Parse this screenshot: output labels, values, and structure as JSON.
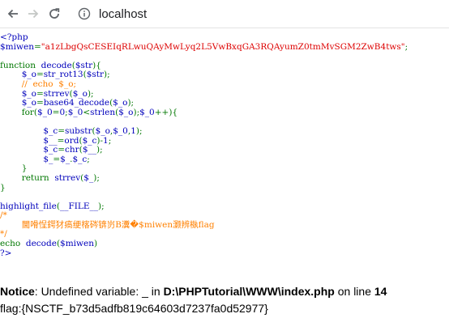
{
  "browser": {
    "url": "localhost"
  },
  "code_lines": [
    [
      {
        "c": "default",
        "t": "<?php"
      }
    ],
    [
      {
        "c": "default",
        "t": "$miwen"
      },
      {
        "c": "keyword",
        "t": "="
      },
      {
        "c": "string",
        "t": "\"a1zLbgQsCESEIqRLwuQAyMwLyq2L5VwBxqGA3RQAyumZ0tmMvSGM2ZwB4tws\""
      },
      {
        "c": "keyword",
        "t": ";"
      }
    ],
    [],
    [
      {
        "c": "keyword",
        "t": "function  "
      },
      {
        "c": "default",
        "t": "decode"
      },
      {
        "c": "keyword",
        "t": "("
      },
      {
        "c": "default",
        "t": "$str"
      },
      {
        "c": "keyword",
        "t": "){"
      }
    ],
    [
      {
        "c": "keyword",
        "t": "        "
      },
      {
        "c": "default",
        "t": "$_o"
      },
      {
        "c": "keyword",
        "t": "="
      },
      {
        "c": "default",
        "t": "str_rot13"
      },
      {
        "c": "keyword",
        "t": "("
      },
      {
        "c": "default",
        "t": "$str"
      },
      {
        "c": "keyword",
        "t": ");"
      }
    ],
    [
      {
        "c": "keyword",
        "t": "        "
      },
      {
        "c": "comment",
        "t": "//  echo  $_o;"
      }
    ],
    [
      {
        "c": "keyword",
        "t": "        "
      },
      {
        "c": "default",
        "t": "$_o"
      },
      {
        "c": "keyword",
        "t": "="
      },
      {
        "c": "default",
        "t": "strrev"
      },
      {
        "c": "keyword",
        "t": "("
      },
      {
        "c": "default",
        "t": "$_o"
      },
      {
        "c": "keyword",
        "t": ");"
      }
    ],
    [
      {
        "c": "keyword",
        "t": "        "
      },
      {
        "c": "default",
        "t": "$_o"
      },
      {
        "c": "keyword",
        "t": "="
      },
      {
        "c": "default",
        "t": "base64_decode"
      },
      {
        "c": "keyword",
        "t": "("
      },
      {
        "c": "default",
        "t": "$_o"
      },
      {
        "c": "keyword",
        "t": ");"
      }
    ],
    [
      {
        "c": "keyword",
        "t": "        for("
      },
      {
        "c": "default",
        "t": "$_0"
      },
      {
        "c": "keyword",
        "t": "="
      },
      {
        "c": "default",
        "t": "0"
      },
      {
        "c": "keyword",
        "t": ";"
      },
      {
        "c": "default",
        "t": "$_0"
      },
      {
        "c": "keyword",
        "t": "<"
      },
      {
        "c": "default",
        "t": "strlen"
      },
      {
        "c": "keyword",
        "t": "("
      },
      {
        "c": "default",
        "t": "$_o"
      },
      {
        "c": "keyword",
        "t": ");"
      },
      {
        "c": "default",
        "t": "$_0"
      },
      {
        "c": "keyword",
        "t": "++){"
      }
    ],
    [],
    [
      {
        "c": "keyword",
        "t": "                "
      },
      {
        "c": "default",
        "t": "$_c"
      },
      {
        "c": "keyword",
        "t": "="
      },
      {
        "c": "default",
        "t": "substr"
      },
      {
        "c": "keyword",
        "t": "("
      },
      {
        "c": "default",
        "t": "$_o"
      },
      {
        "c": "keyword",
        "t": ","
      },
      {
        "c": "default",
        "t": "$_0"
      },
      {
        "c": "keyword",
        "t": ","
      },
      {
        "c": "default",
        "t": "1"
      },
      {
        "c": "keyword",
        "t": ");"
      }
    ],
    [
      {
        "c": "keyword",
        "t": "                "
      },
      {
        "c": "default",
        "t": "$__"
      },
      {
        "c": "keyword",
        "t": "="
      },
      {
        "c": "default",
        "t": "ord"
      },
      {
        "c": "keyword",
        "t": "("
      },
      {
        "c": "default",
        "t": "$_c"
      },
      {
        "c": "keyword",
        "t": ")-"
      },
      {
        "c": "default",
        "t": "1"
      },
      {
        "c": "keyword",
        "t": ";"
      }
    ],
    [
      {
        "c": "keyword",
        "t": "                "
      },
      {
        "c": "default",
        "t": "$_c"
      },
      {
        "c": "keyword",
        "t": "="
      },
      {
        "c": "default",
        "t": "chr"
      },
      {
        "c": "keyword",
        "t": "("
      },
      {
        "c": "default",
        "t": "$__"
      },
      {
        "c": "keyword",
        "t": ");"
      }
    ],
    [
      {
        "c": "keyword",
        "t": "                "
      },
      {
        "c": "default",
        "t": "$_"
      },
      {
        "c": "keyword",
        "t": "="
      },
      {
        "c": "default",
        "t": "$_"
      },
      {
        "c": "keyword",
        "t": "."
      },
      {
        "c": "default",
        "t": "$_c"
      },
      {
        "c": "keyword",
        "t": ";"
      }
    ],
    [
      {
        "c": "keyword",
        "t": "        }"
      }
    ],
    [
      {
        "c": "keyword",
        "t": "        return  "
      },
      {
        "c": "default",
        "t": "strrev"
      },
      {
        "c": "keyword",
        "t": "("
      },
      {
        "c": "default",
        "t": "$_"
      },
      {
        "c": "keyword",
        "t": ");"
      }
    ],
    [
      {
        "c": "keyword",
        "t": "}"
      }
    ],
    [],
    [
      {
        "c": "default",
        "t": "highlight_file"
      },
      {
        "c": "keyword",
        "t": "("
      },
      {
        "c": "default",
        "t": "__FILE__"
      },
      {
        "c": "keyword",
        "t": ");"
      }
    ],
    [
      {
        "c": "comment",
        "t": "/*"
      }
    ],
    [
      {
        "c": "comment",
        "t": "        閫嗗悜鍔犲瘑绠楁硶锛岃В瀵�$miwen灏辨槸flag"
      }
    ],
    [
      {
        "c": "comment",
        "t": "*/"
      }
    ],
    [
      {
        "c": "keyword",
        "t": "echo  "
      },
      {
        "c": "default",
        "t": "decode"
      },
      {
        "c": "keyword",
        "t": "("
      },
      {
        "c": "default",
        "t": "$miwen"
      },
      {
        "c": "keyword",
        "t": ")"
      }
    ],
    [
      {
        "c": "default",
        "t": "?>"
      }
    ]
  ],
  "notice": {
    "label": "Notice",
    "message": ": Undefined variable: _ in ",
    "path": "D:\\PHPTutorial\\WWW\\index.php",
    "on_line": " on line ",
    "line_no": "14"
  },
  "output": {
    "flag": "flag:{NSCTF_b73d5adfb819c64603d7237fa0d52977}"
  }
}
